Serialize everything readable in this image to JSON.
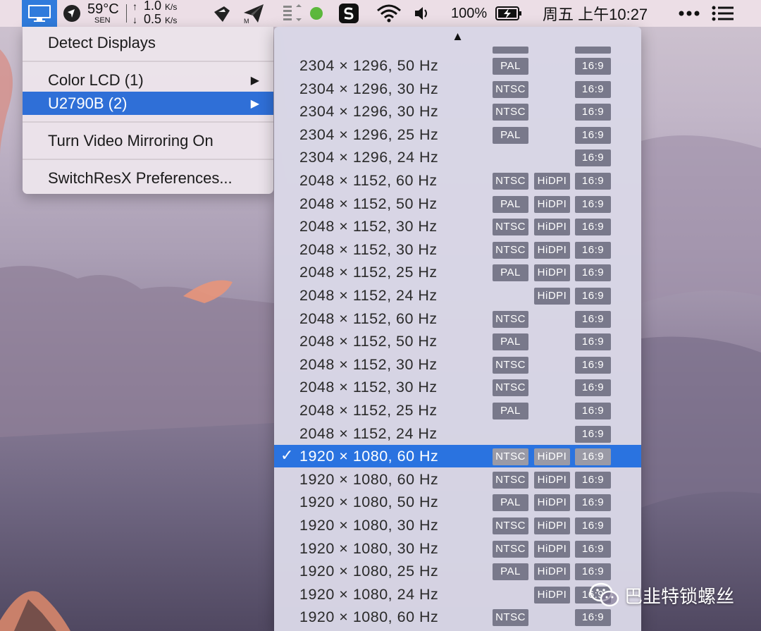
{
  "menubar": {
    "temperature": "59°C",
    "temperature_sub": "SEN",
    "upload_speed": "1.0",
    "download_speed": "0.5",
    "speed_unit": "K/s",
    "battery_percent": "100%",
    "clock": "周五 上午10:27"
  },
  "display_menu": {
    "items": [
      {
        "label": "Detect Displays"
      },
      {
        "label": "Color LCD (1)"
      },
      {
        "label": "U2790B (2)"
      },
      {
        "label": "Turn Video Mirroring On"
      },
      {
        "label": "SwitchResX Preferences..."
      }
    ],
    "selected_index": 2
  },
  "resolution_menu": {
    "rows": [
      {
        "label": "2304 × 1296, 50 Hz",
        "type": "PAL",
        "hidpi": "",
        "ratio": "16:9",
        "checked": false
      },
      {
        "label": "2304 × 1296, 30 Hz",
        "type": "NTSC",
        "hidpi": "",
        "ratio": "16:9",
        "checked": false
      },
      {
        "label": "2304 × 1296, 30 Hz",
        "type": "NTSC",
        "hidpi": "",
        "ratio": "16:9",
        "checked": false
      },
      {
        "label": "2304 × 1296, 25 Hz",
        "type": "PAL",
        "hidpi": "",
        "ratio": "16:9",
        "checked": false
      },
      {
        "label": "2304 × 1296, 24 Hz",
        "type": "",
        "hidpi": "",
        "ratio": "16:9",
        "checked": false
      },
      {
        "label": "2048 × 1152, 60 Hz",
        "type": "NTSC",
        "hidpi": "HiDPI",
        "ratio": "16:9",
        "checked": false
      },
      {
        "label": "2048 × 1152, 50 Hz",
        "type": "PAL",
        "hidpi": "HiDPI",
        "ratio": "16:9",
        "checked": false
      },
      {
        "label": "2048 × 1152, 30 Hz",
        "type": "NTSC",
        "hidpi": "HiDPI",
        "ratio": "16:9",
        "checked": false
      },
      {
        "label": "2048 × 1152, 30 Hz",
        "type": "NTSC",
        "hidpi": "HiDPI",
        "ratio": "16:9",
        "checked": false
      },
      {
        "label": "2048 × 1152, 25 Hz",
        "type": "PAL",
        "hidpi": "HiDPI",
        "ratio": "16:9",
        "checked": false
      },
      {
        "label": "2048 × 1152, 24 Hz",
        "type": "",
        "hidpi": "HiDPI",
        "ratio": "16:9",
        "checked": false
      },
      {
        "label": "2048 × 1152, 60 Hz",
        "type": "NTSC",
        "hidpi": "",
        "ratio": "16:9",
        "checked": false
      },
      {
        "label": "2048 × 1152, 50 Hz",
        "type": "PAL",
        "hidpi": "",
        "ratio": "16:9",
        "checked": false
      },
      {
        "label": "2048 × 1152, 30 Hz",
        "type": "NTSC",
        "hidpi": "",
        "ratio": "16:9",
        "checked": false
      },
      {
        "label": "2048 × 1152, 30 Hz",
        "type": "NTSC",
        "hidpi": "",
        "ratio": "16:9",
        "checked": false
      },
      {
        "label": "2048 × 1152, 25 Hz",
        "type": "PAL",
        "hidpi": "",
        "ratio": "16:9",
        "checked": false
      },
      {
        "label": "2048 × 1152, 24 Hz",
        "type": "",
        "hidpi": "",
        "ratio": "16:9",
        "checked": false
      },
      {
        "label": "1920 × 1080, 60 Hz",
        "type": "NTSC",
        "hidpi": "HiDPI",
        "ratio": "16:9",
        "checked": true
      },
      {
        "label": "1920 × 1080, 60 Hz",
        "type": "NTSC",
        "hidpi": "HiDPI",
        "ratio": "16:9",
        "checked": false
      },
      {
        "label": "1920 × 1080, 50 Hz",
        "type": "PAL",
        "hidpi": "HiDPI",
        "ratio": "16:9",
        "checked": false
      },
      {
        "label": "1920 × 1080, 30 Hz",
        "type": "NTSC",
        "hidpi": "HiDPI",
        "ratio": "16:9",
        "checked": false
      },
      {
        "label": "1920 × 1080, 30 Hz",
        "type": "NTSC",
        "hidpi": "HiDPI",
        "ratio": "16:9",
        "checked": false
      },
      {
        "label": "1920 × 1080, 25 Hz",
        "type": "PAL",
        "hidpi": "HiDPI",
        "ratio": "16:9",
        "checked": false
      },
      {
        "label": "1920 × 1080, 24 Hz",
        "type": "",
        "hidpi": "HiDPI",
        "ratio": "16:9",
        "checked": false
      },
      {
        "label": "1920 × 1080, 60 Hz",
        "type": "NTSC",
        "hidpi": "",
        "ratio": "16:9",
        "checked": false
      }
    ]
  },
  "watermark": {
    "text": "巴韭特锁螺丝"
  },
  "colors": {
    "selection": "#2a73e0",
    "badge": "#79798b",
    "status_dot": "#5cb83c"
  }
}
